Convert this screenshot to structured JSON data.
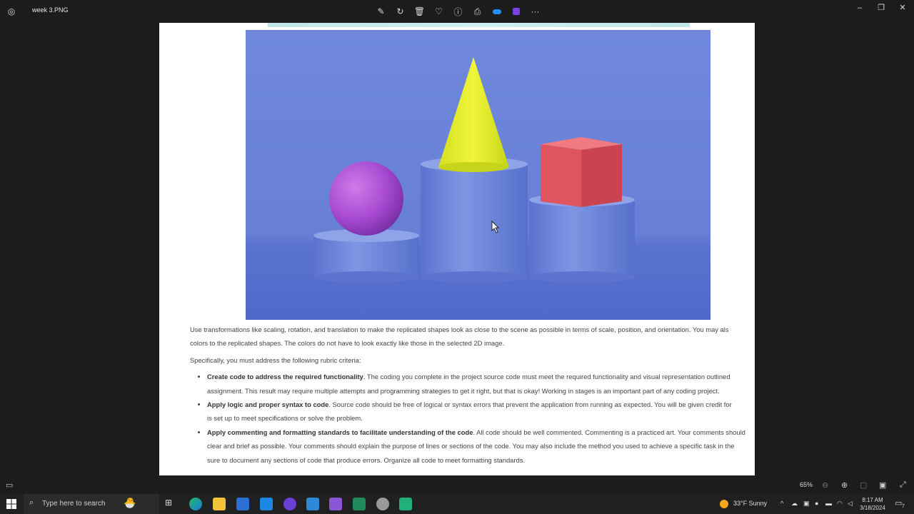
{
  "window": {
    "title": "week 3.PNG"
  },
  "toolbar": {
    "items": [
      "edit-icon",
      "rotate-icon",
      "delete-icon",
      "favorite-icon",
      "info-icon",
      "print-icon",
      "onedrive-icon",
      "clipchamp-icon",
      "more-icon"
    ]
  },
  "document": {
    "para1_line1": "Use transformations like scaling, rotation, and translation to make the replicated shapes look as close to the scene as possible in terms of scale, position, and orientation. You may als",
    "para1_line2": "colors to the replicated shapes. The colors do not have to look exactly like those in the selected 2D image.",
    "para2": "Specifically, you must address the following rubric criteria:",
    "bullets": [
      {
        "bold": "Create code to address the required functionality",
        "rest": ". The coding you complete in the project source code must meet the required functionality and visual representation outlined",
        "cont": "assignment. This result may require multiple attempts and programming strategies to get it right, but that is okay! Working in stages is an important part of any coding project."
      },
      {
        "bold": "Apply logic and proper syntax to code",
        "rest": ". Source code should be free of logical or syntax errors that prevent the application from running as expected. You will be given credit for",
        "cont": "is set up to meet specifications or solve the problem."
      },
      {
        "bold": "Apply commenting and formatting standards to facilitate understanding of the code",
        "rest": ". All code should be well commented. Commenting is a practiced art. Your comments should",
        "cont": "clear and brief as possible. Your comments should explain the purpose of lines or sections of the code. You may also include the method you used to achieve a specific task in the",
        "cont2": "sure to document any sections of code that produce errors. Organize all code to meet formatting standards."
      }
    ]
  },
  "statusbar": {
    "zoom": "65%"
  },
  "taskbar": {
    "search_placeholder": "Type here to search",
    "weather": "33°F  Sunny",
    "time": "8:17 AM",
    "date": "3/18/2024",
    "notification_count": "7"
  },
  "colors": {
    "scene_bg": "#6d86da",
    "sphere": "#b14fd6",
    "cone": "#e6f02e",
    "cube": "#e55a63"
  }
}
